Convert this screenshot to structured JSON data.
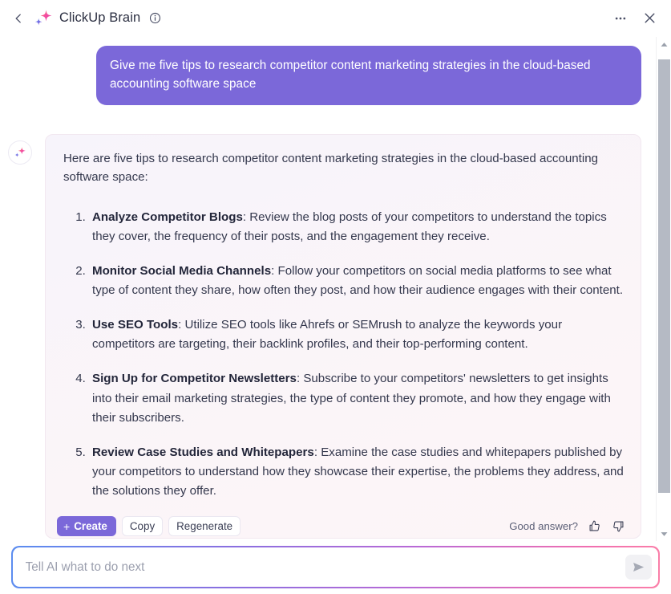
{
  "header": {
    "back_icon": "chevron-left-icon",
    "logo_icon": "sparkle-logo-icon",
    "title": "ClickUp Brain",
    "info_icon": "info-circle-icon",
    "more_icon": "more-horizontal-icon",
    "close_icon": "close-icon"
  },
  "conversation": {
    "user_message": "Give me five tips to research competitor content marketing strategies in the cloud-based accounting software space",
    "assistant": {
      "avatar_icon": "sparkle-avatar-icon",
      "intro": "Here are five tips to research competitor content marketing strategies in the cloud-based accounting software space:",
      "tips": [
        {
          "title": "Analyze Competitor Blogs",
          "body": ": Review the blog posts of your competitors to understand the topics they cover, the frequency of their posts, and the engagement they receive."
        },
        {
          "title": "Monitor Social Media Channels",
          "body": ": Follow your competitors on social media platforms to see what type of content they share, how often they post, and how their audience engages with their content."
        },
        {
          "title": "Use SEO Tools",
          "body": ": Utilize SEO tools like Ahrefs or SEMrush to analyze the keywords your competitors are targeting, their backlink profiles, and their top-performing content."
        },
        {
          "title": "Sign Up for Competitor Newsletters",
          "body": ": Subscribe to your competitors' newsletters to get insights into their email marketing strategies, the type of content they promote, and how they engage with their subscribers."
        },
        {
          "title": "Review Case Studies and Whitepapers",
          "body": ": Examine the case studies and whitepapers published by your competitors to understand how they showcase their expertise, the problems they address, and the solutions they offer."
        }
      ],
      "actions": {
        "create_plus": "+",
        "create_label": "Create",
        "copy_label": "Copy",
        "regenerate_label": "Regenerate"
      },
      "feedback": {
        "label": "Good answer?",
        "thumbs_up_icon": "thumbs-up-icon",
        "thumbs_down_icon": "thumbs-down-icon"
      }
    }
  },
  "composer": {
    "placeholder": "Tell AI what to do next",
    "value": "",
    "send_icon": "send-plane-icon"
  },
  "scrollbar": {
    "up_icon": "scroll-up-arrow-icon",
    "down_icon": "scroll-down-arrow-icon"
  },
  "colors": {
    "brand_purple": "#7b68d9",
    "card_bg": "#f9f4f9",
    "accent_pink": "#f06fb0",
    "accent_blue": "#5b8df0"
  }
}
